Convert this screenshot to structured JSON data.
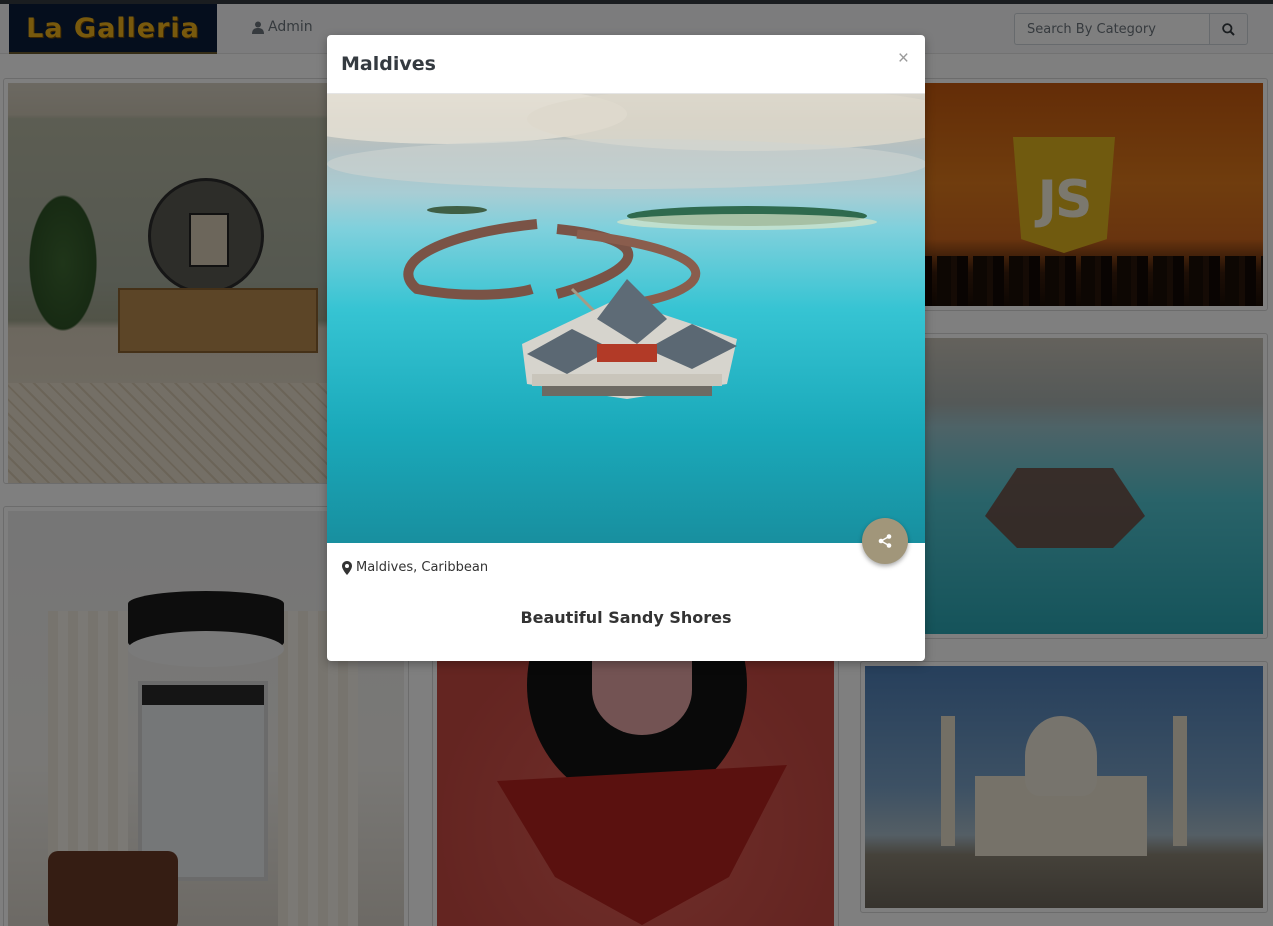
{
  "navbar": {
    "brand": "La Galleria",
    "admin_label": "Admin",
    "search_placeholder": "Search By Category"
  },
  "gallery": {
    "cards": [
      {
        "name": "living-room"
      },
      {
        "name": "javascript"
      },
      {
        "name": "maldives"
      },
      {
        "name": "pendant-lamp"
      },
      {
        "name": "dog"
      },
      {
        "name": "taj-mahal"
      }
    ]
  },
  "modal": {
    "title": "Maldives",
    "close_label": "×",
    "location": "Maldives, Caribbean",
    "caption": "Beautiful Sandy Shores"
  },
  "icons": {
    "user": "user-icon",
    "search": "search-icon",
    "map_marker": "map-marker-icon",
    "share": "share-icon"
  },
  "colors": {
    "brand_bg": "#0b1d3a",
    "brand_text": "#f0b21a",
    "share_button": "#a1967a",
    "overlay": "rgba(0,0,0,0.5)"
  }
}
